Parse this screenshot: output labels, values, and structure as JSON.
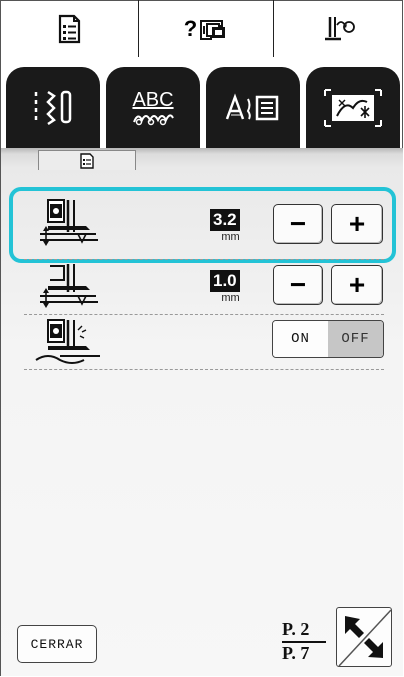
{
  "top_bar": {
    "buttons": [
      {
        "icon": "settings-screen-icon"
      },
      {
        "icon": "help-machine-icon",
        "label": "?"
      },
      {
        "icon": "needle-threading-icon"
      }
    ]
  },
  "tabs": [
    {
      "icon": "utility-stitch-icon"
    },
    {
      "icon": "character-decorative-icon",
      "label": "ABC"
    },
    {
      "icon": "font-edit-icon"
    },
    {
      "icon": "embroidery-icon"
    }
  ],
  "panel": {
    "tab_icon": "settings-list-icon",
    "settings": [
      {
        "icon": "presser-foot-height-icon",
        "value": "3.2",
        "unit": "mm",
        "minus": "−",
        "plus": "+"
      },
      {
        "icon": "presser-foot-pressure-icon",
        "value": "1.0",
        "unit": "mm",
        "minus": "−",
        "plus": "+"
      },
      {
        "icon": "pivot-foot-icon",
        "on": "ON",
        "off": "OFF",
        "selected": "OFF"
      }
    ],
    "accent_color": "#23c3d6"
  },
  "footer": {
    "close_label": "CERRAR",
    "page_current": "P. 2",
    "page_total": "P. 7",
    "pager_icon": "page-navigate-icon"
  }
}
